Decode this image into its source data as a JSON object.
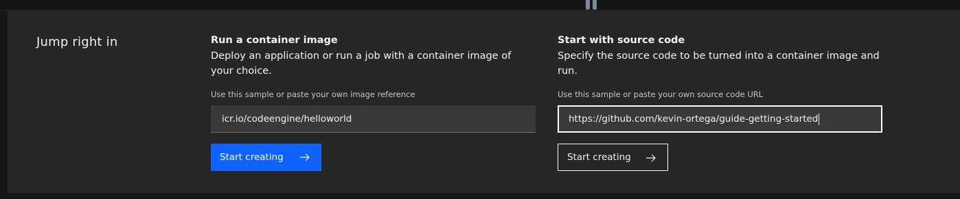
{
  "jump": {
    "title": "Jump right in"
  },
  "container_card": {
    "heading": "Run a container image",
    "description": "Deploy an application or run a job with a container image of your choice.",
    "field_label": "Use this sample or paste your own image reference",
    "input_value": "icr.io/codeengine/helloworld",
    "button_label": "Start creating",
    "button_icon": "arrow-right-icon"
  },
  "source_card": {
    "heading": "Start with source code",
    "description": "Specify the source code to be turned into a container image and run.",
    "field_label": "Use this sample or paste your own source code URL",
    "input_value": "https://github.com/kevin-ortega/guide-getting-started",
    "button_label": "Start creating",
    "button_icon": "arrow-right-icon"
  },
  "colors": {
    "background": "#161616",
    "panel": "#262626",
    "primary_button": "#0f62fe",
    "input_bg": "#393939",
    "text": "#f4f4f4",
    "label_text": "#c6c6c6"
  }
}
